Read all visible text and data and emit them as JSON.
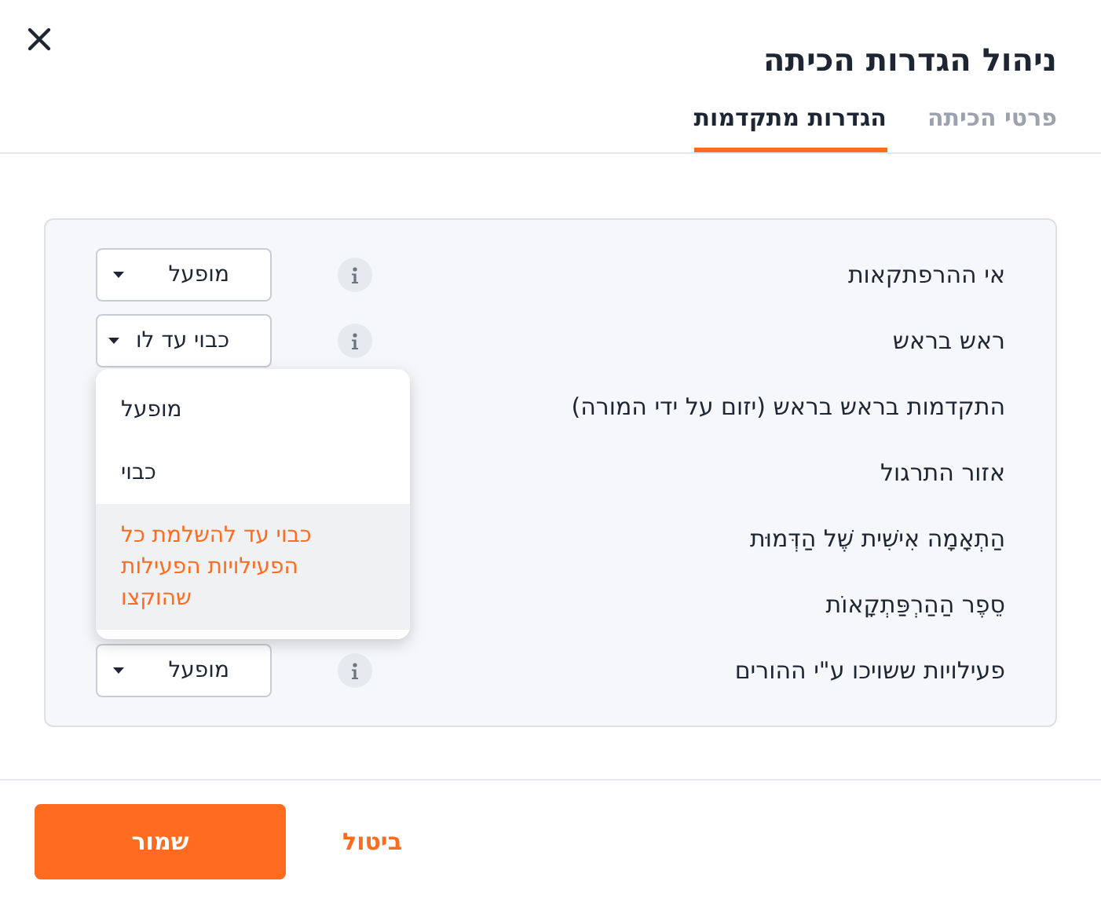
{
  "dialog": {
    "title": "ניהול הגדרות הכיתה"
  },
  "tabs": [
    {
      "label": "פרטי הכיתה",
      "selected": false
    },
    {
      "label": "הגדרות מתקדמות",
      "selected": true
    }
  ],
  "settings": [
    {
      "label": "אי ההרפתקאות",
      "control": {
        "value": "מופעל"
      }
    },
    {
      "label": "ראש בראש",
      "control": {
        "value": "כבוי עד לו",
        "options": [
          {
            "label": "מופעל",
            "selected": false
          },
          {
            "label": "כבוי",
            "selected": false
          },
          {
            "label": "כבוי עד להשלמת כל הפעילויות הפעילות שהוקצו",
            "selected": true
          }
        ]
      }
    },
    {
      "label": "התקדמות בראש בראש (יזום על ידי המורה)"
    },
    {
      "label": "אזור התרגול"
    },
    {
      "label": "הַתְאָמָה אִישִׁית שֶׁל הַדְּמוּת"
    },
    {
      "label": "סֵפֶר הַהַרְפַּתְקָאוֹת"
    },
    {
      "label": "פעילויות ששויכו ע\"י ההורים",
      "control": {
        "value": "מופעל"
      }
    }
  ],
  "buttons": {
    "save": "שמור",
    "cancel": "ביטול"
  }
}
